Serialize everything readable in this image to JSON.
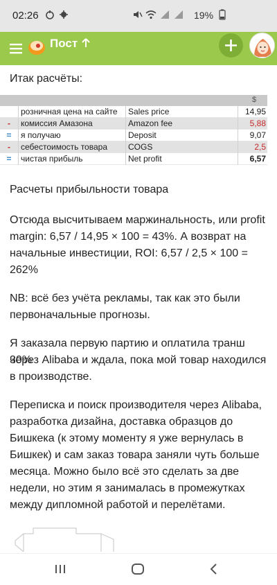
{
  "status": {
    "time": "02:26",
    "battery": "19%"
  },
  "app_bar": {
    "title": "Пост",
    "colors": {
      "bar": "#9bc94c",
      "add_button": "#7fae37"
    }
  },
  "content": {
    "intro": "Итак расчёты:",
    "table": {
      "currency_header": "$",
      "rows": [
        {
          "sign": "",
          "ru": "розничная цена на сайте",
          "en": "Sales price",
          "value": "14,95"
        },
        {
          "sign": "-",
          "ru": "комиссия Амазона",
          "en": "Amazon fee",
          "value": "5,88"
        },
        {
          "sign": "=",
          "ru": "я получаю",
          "en": "Deposit",
          "value": "9,07"
        },
        {
          "sign": "-",
          "ru": "себестоимость товара",
          "en": "COGS",
          "value": "2,5"
        },
        {
          "sign": "=",
          "ru": "чистая прибыль",
          "en": "Net profit",
          "value": "6,57"
        }
      ]
    },
    "caption": "Расчеты прибыльности товара",
    "para_margin_1": "Отсюда высчитываем маржинальность, или profit",
    "para_margin_2": "margin: 6,57 / 14,95 × 100 = 43%. А возврат на",
    "para_margin_3": "начальные инвестиции, ROI: 6,57 / 2,5 × 100 =",
    "para_margin_4": "262%",
    "para_nb_1": "NB: всё без учёта рекламы, так как это были",
    "para_nb_2": "первоначальные прогнозы.",
    "para_order_1": "Я заказала первую партию и оплатила транш 30%",
    "para_order_2": "через Alibaba и ждала, пока мой товар находился",
    "para_order_3": "в производстве.",
    "para_corr_1": "Переписка и поиск производителя через Alibaba,",
    "para_corr_2": "разработка дизайна, доставка образцов до",
    "para_corr_3": "Бишкека (к этому моменту я уже вернулась в",
    "para_corr_4": "Бишкек) и сам заказ товара заняли чуть больше",
    "para_corr_5": "месяца. Можно было всё это сделать за две",
    "para_corr_6": "недели, но этим я занималась в промежутках",
    "para_corr_7": "между дипломной работой и перелётами."
  },
  "icons": {
    "menu": "hamburger-icon",
    "logo": "app-logo-icon",
    "up": "arrow-up-icon",
    "add": "plus-icon",
    "nav_recent": "recent-apps-icon",
    "nav_home": "home-icon",
    "nav_back": "back-icon"
  }
}
